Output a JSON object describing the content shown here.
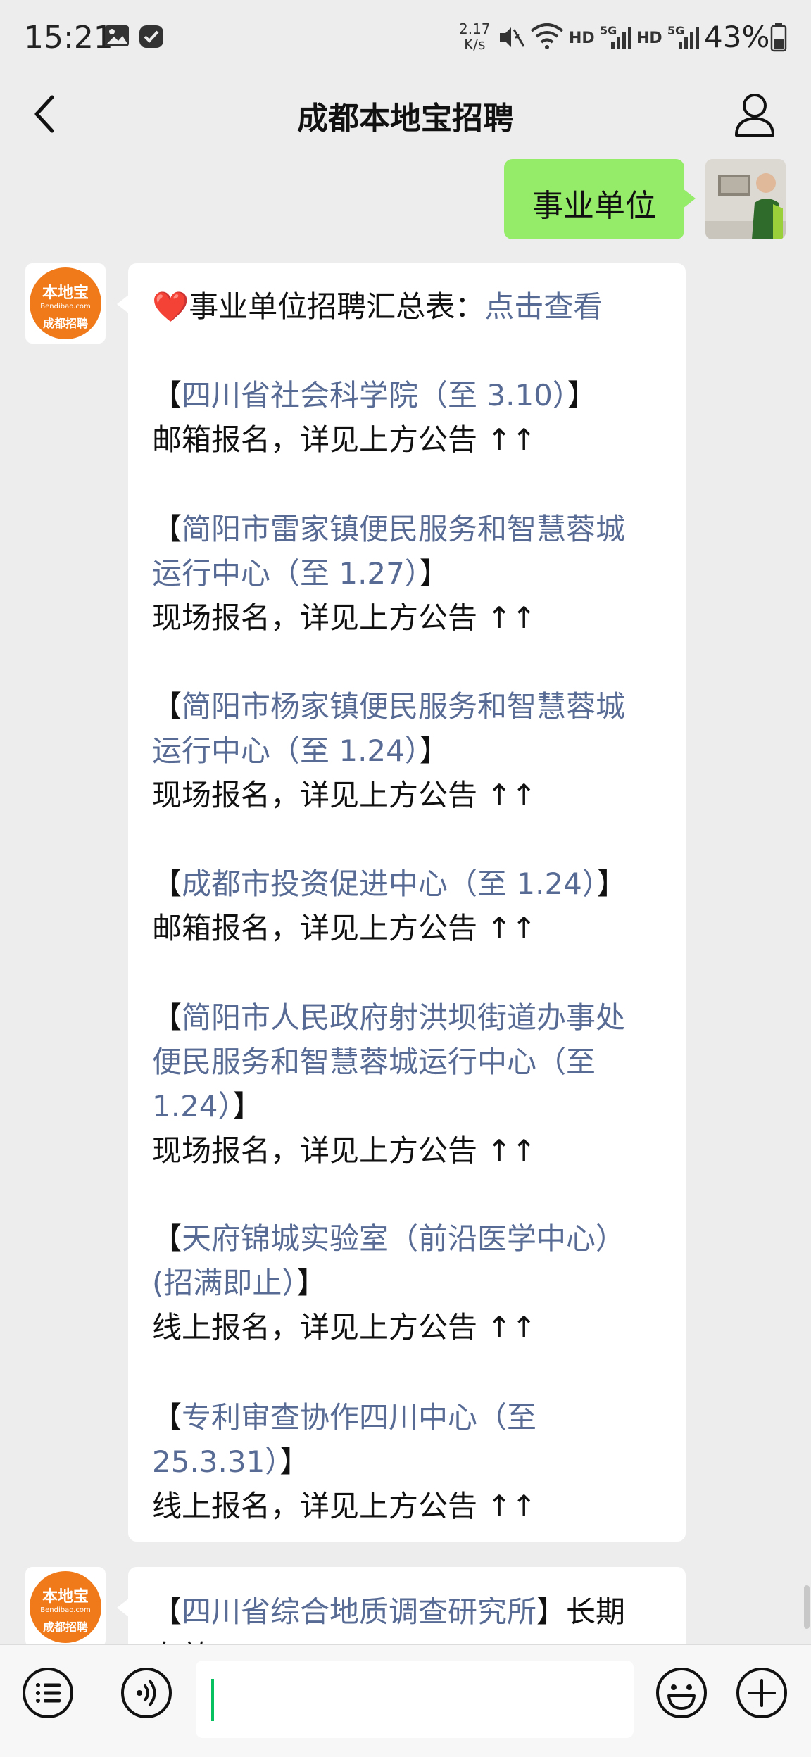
{
  "status_bar": {
    "time": "15:21",
    "net_speed_value": "2.17",
    "net_speed_unit": "K/s",
    "hd1": "HD",
    "hd2": "HD",
    "signal_5g_1": "5G",
    "signal_5g_2": "5G",
    "battery": "43%",
    "icons": [
      "gallery-icon",
      "app-check-icon",
      "mute-icon",
      "wifi-icon",
      "signal-icon",
      "battery-icon"
    ]
  },
  "nav": {
    "title": "成都本地宝招聘",
    "icons": [
      "back-arrow-icon",
      "profile-icon"
    ]
  },
  "sent_message": {
    "text": "事业单位"
  },
  "bot_avatar": {
    "logo_top": "本地宝",
    "logo_mid": "Bendibao.com",
    "logo_bottom": "成都招聘"
  },
  "reply": {
    "heart": "❤️",
    "summary_label": "事业单位招聘汇总表：",
    "summary_link": "点击查看",
    "entries": [
      {
        "lines": [
          {
            "link": "四川省社会科学院（至 3.10）",
            "close": "】"
          }
        ],
        "note": "邮箱报名，详见上方公告 ↑↑"
      },
      {
        "lines": [
          {
            "link": "简阳市雷家镇便民服务和智慧蓉城"
          },
          {
            "link": "运行中心（至 1.27）",
            "close": "】"
          }
        ],
        "note": "现场报名，详见上方公告 ↑↑"
      },
      {
        "lines": [
          {
            "link": "简阳市杨家镇便民服务和智慧蓉城"
          },
          {
            "link": "运行中心（至 1.24）",
            "close": "】"
          }
        ],
        "note": "现场报名，详见上方公告 ↑↑"
      },
      {
        "lines": [
          {
            "link": "成都市投资促进中心（至 1.24）",
            "close": "】"
          }
        ],
        "note": "邮箱报名，详见上方公告 ↑↑"
      },
      {
        "lines": [
          {
            "link": "简阳市人民政府射洪坝街道办事处"
          },
          {
            "link": "便民服务和智慧蓉城运行中心（至"
          },
          {
            "link": "1.24）",
            "close": "】"
          }
        ],
        "note": "现场报名，详见上方公告 ↑↑"
      },
      {
        "lines": [
          {
            "link": "天府锦城实验室（前沿医学中心）"
          },
          {
            "link": "(招满即止）",
            "close": "】"
          }
        ],
        "note": "线上报名，详见上方公告 ↑↑"
      },
      {
        "lines": [
          {
            "link": "专利审查协作四川中心（至"
          },
          {
            "link": "25.3.31）",
            "close": "】"
          }
        ],
        "note": "线上报名，详见上方公告 ↑↑"
      }
    ]
  },
  "next_reply": {
    "link": "四川省综合地质调查研究所",
    "close": "】",
    "suffix": "长期",
    "cut_line": "有效"
  },
  "input_bar": {
    "icons": [
      "menu-list-icon",
      "voice-icon",
      "emoji-icon",
      "plus-icon"
    ]
  },
  "colors": {
    "link": "#576b95",
    "sent_bubble": "#95ec69",
    "background": "#ededed",
    "caret": "#07c160"
  }
}
